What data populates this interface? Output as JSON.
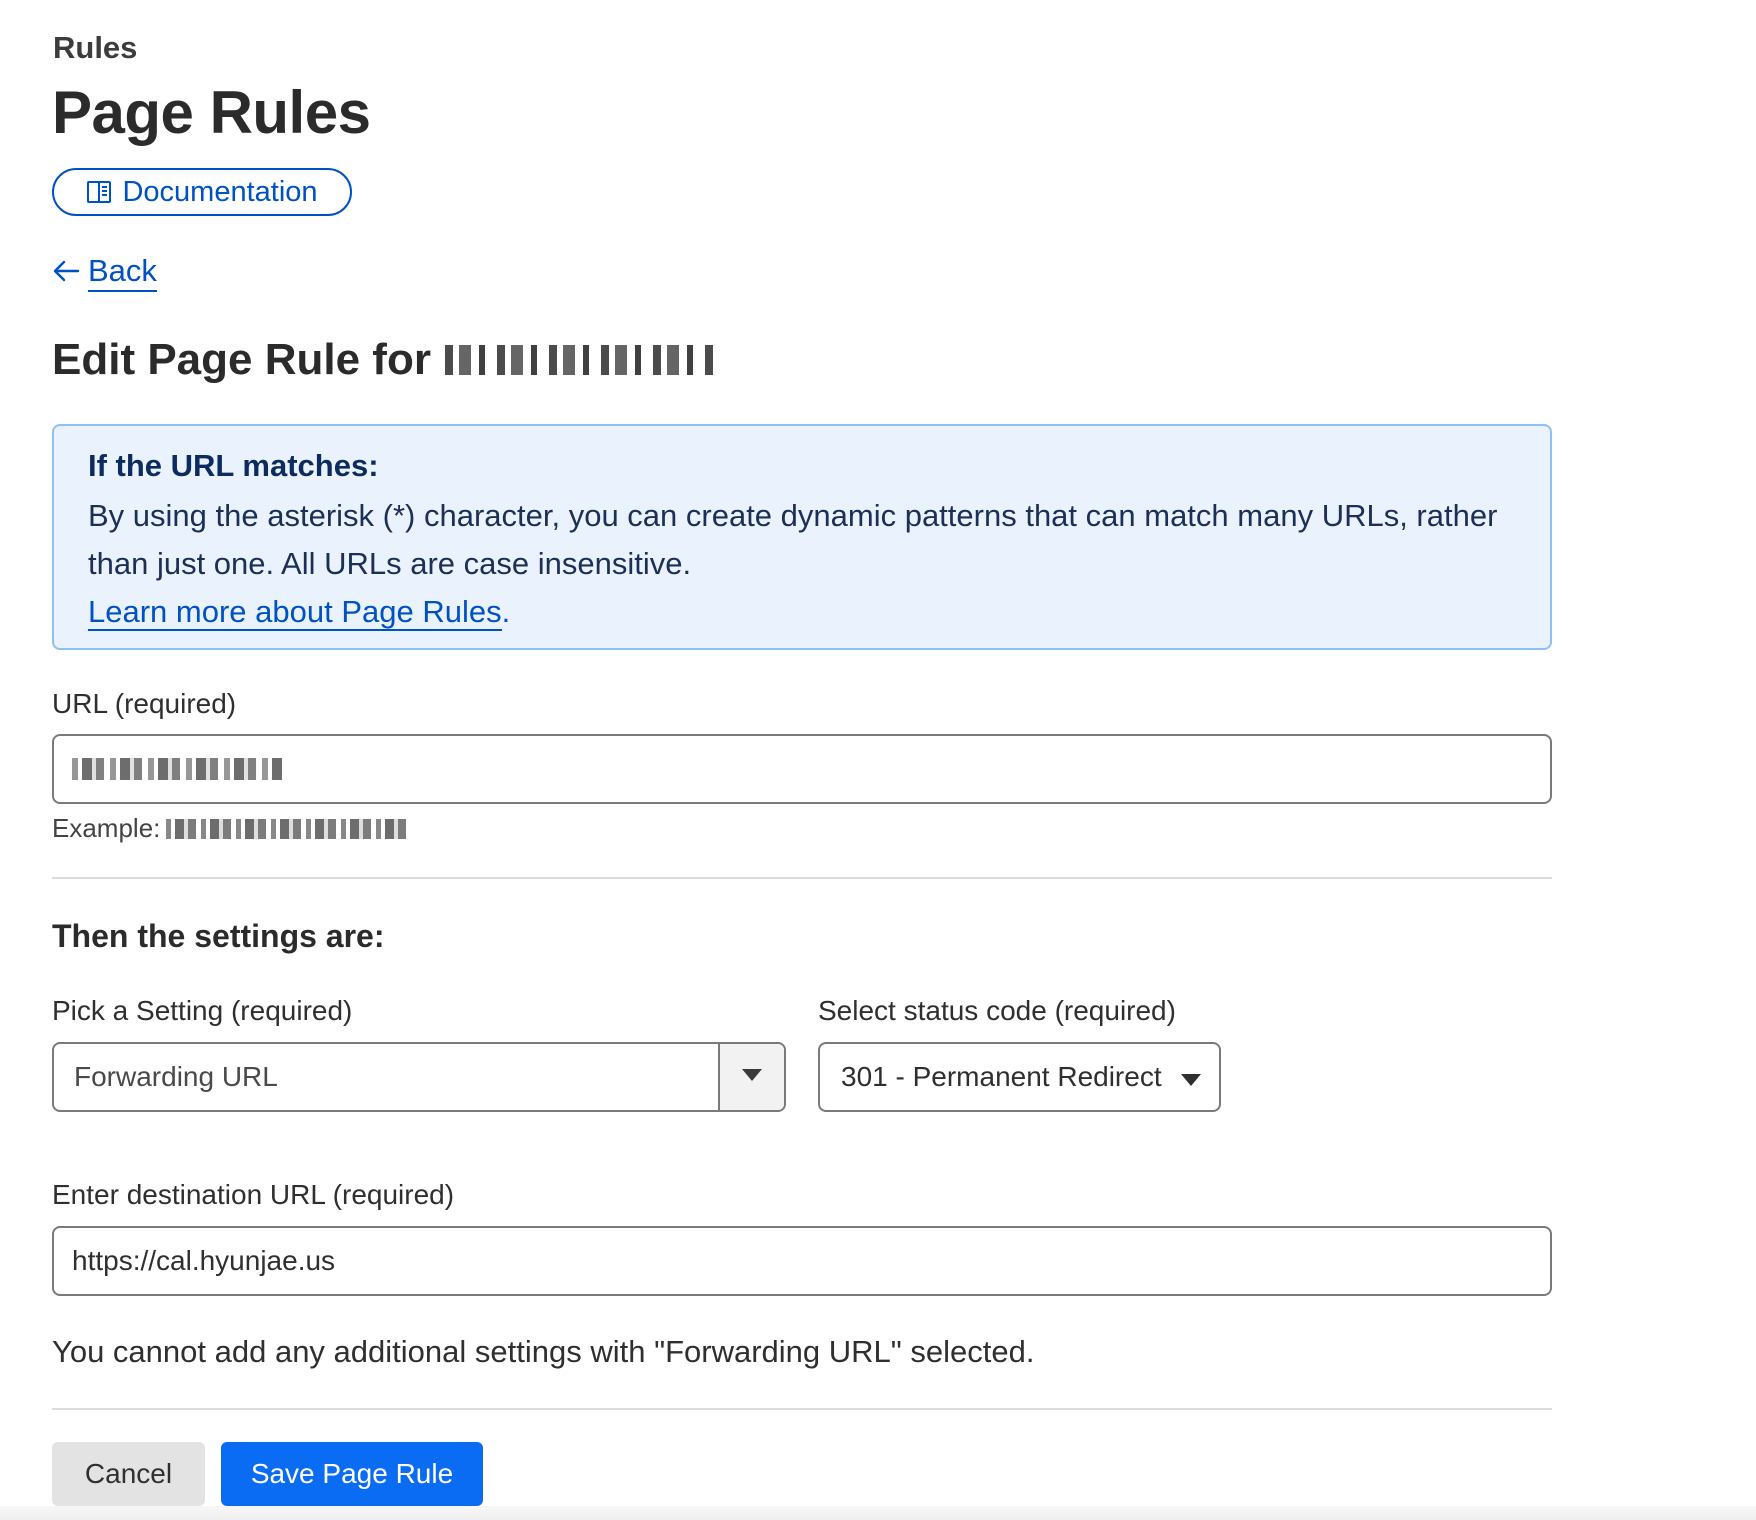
{
  "header": {
    "section": "Rules",
    "title": "Page Rules",
    "documentation_label": "Documentation",
    "back_label": "Back"
  },
  "edit": {
    "heading": "Edit Page Rule for"
  },
  "info": {
    "title": "If the URL matches:",
    "text": "By using the asterisk (*) character, you can create dynamic patterns that can match many URLs, rather than just one. All URLs are case insensitive.",
    "link_text": "Learn more about Page Rules",
    "link_suffix": "."
  },
  "url_field": {
    "label": "URL (required)",
    "example_prefix": "Example:"
  },
  "settings": {
    "heading": "Then the settings are:",
    "pick_label": "Pick a Setting (required)",
    "pick_value": "Forwarding URL",
    "status_label": "Select status code (required)",
    "status_value": "301 - Permanent Redirect",
    "destination_label": "Enter destination URL (required)",
    "destination_value": "https://cal.hyunjae.us",
    "notice": "You cannot add any additional settings with \"Forwarding URL\" selected."
  },
  "actions": {
    "cancel_label": "Cancel",
    "save_label": "Save Page Rule"
  },
  "colors": {
    "accent": "#0051c3",
    "primary_button": "#0a6cf2",
    "info_background": "#eaf2fd",
    "info_border": "#8fc0f5"
  },
  "icons": {
    "documentation": "book-icon",
    "back": "arrow-left-icon",
    "pick_dropdown": "caret-down-icon",
    "status_dropdown": "caret-down-icon"
  }
}
